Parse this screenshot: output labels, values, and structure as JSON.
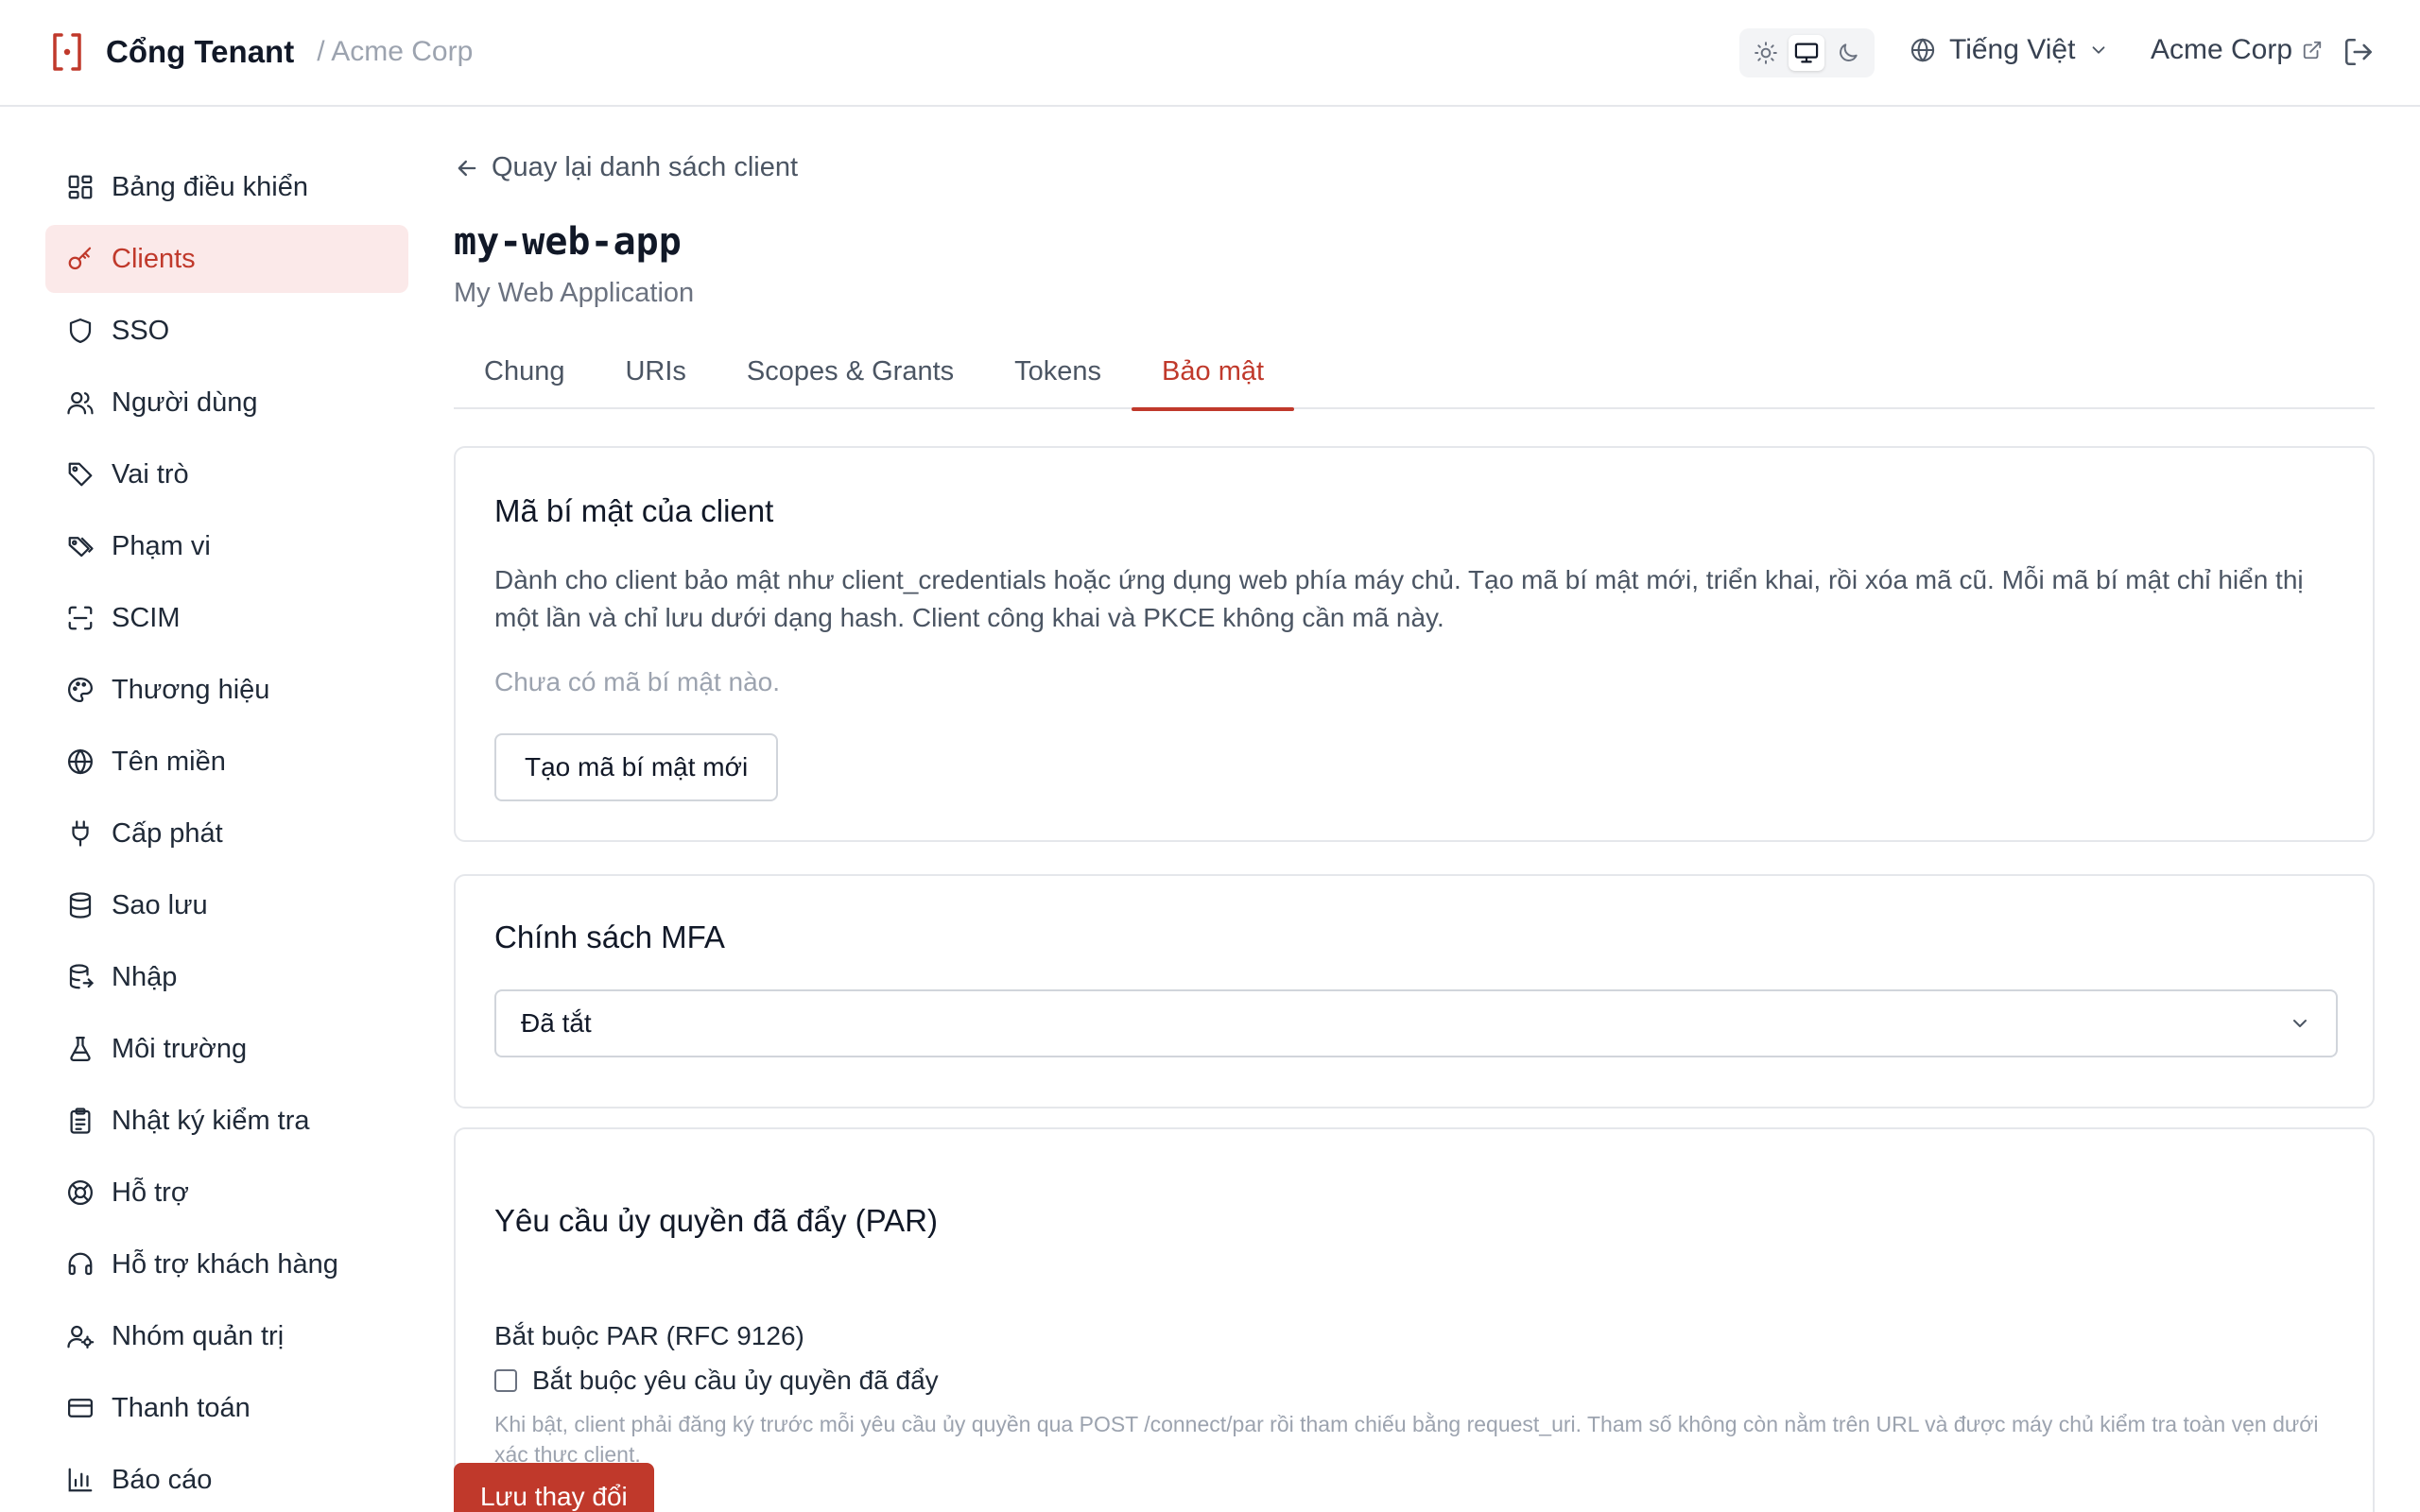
{
  "header": {
    "brand_name": "Cổng Tenant",
    "breadcrumb_org": "/ Acme Corp",
    "language": "Tiếng Việt",
    "org_name": "Acme Corp",
    "accent_color": "#c0392b"
  },
  "sidebar": {
    "items": [
      {
        "label": "Bảng điều khiển",
        "icon": "dashboard-icon"
      },
      {
        "label": "Clients",
        "icon": "key-icon",
        "active": true
      },
      {
        "label": "SSO",
        "icon": "shield-icon"
      },
      {
        "label": "Người dùng",
        "icon": "users-icon"
      },
      {
        "label": "Vai trò",
        "icon": "tag-icon"
      },
      {
        "label": "Phạm vi",
        "icon": "tags-icon"
      },
      {
        "label": "SCIM",
        "icon": "scan-icon"
      },
      {
        "label": "Thương hiệu",
        "icon": "palette-icon"
      },
      {
        "label": "Tên miền",
        "icon": "globe-icon"
      },
      {
        "label": "Cấp phát",
        "icon": "plug-icon"
      },
      {
        "label": "Sao lưu",
        "icon": "database-icon"
      },
      {
        "label": "Nhập",
        "icon": "database-import-icon"
      },
      {
        "label": "Môi trường",
        "icon": "flask-icon"
      },
      {
        "label": "Nhật ký kiểm tra",
        "icon": "clipboard-icon"
      },
      {
        "label": "Hỗ trợ",
        "icon": "lifebuoy-icon"
      },
      {
        "label": "Hỗ trợ khách hàng",
        "icon": "headset-icon"
      },
      {
        "label": "Nhóm quản trị",
        "icon": "user-cog-icon"
      },
      {
        "label": "Thanh toán",
        "icon": "credit-card-icon"
      },
      {
        "label": "Báo cáo",
        "icon": "bar-chart-icon"
      }
    ]
  },
  "main": {
    "back_link": "Quay lại danh sách client",
    "client_id": "my-web-app",
    "client_name": "My Web Application",
    "tabs": [
      {
        "label": "Chung"
      },
      {
        "label": "URIs"
      },
      {
        "label": "Scopes & Grants"
      },
      {
        "label": "Tokens"
      },
      {
        "label": "Bảo mật",
        "active": true
      }
    ],
    "secret_card": {
      "title": "Mã bí mật của client",
      "description": "Dành cho client bảo mật như client_credentials hoặc ứng dụng web phía máy chủ. Tạo mã bí mật mới, triển khai, rồi xóa mã cũ. Mỗi mã bí mật chỉ hiển thị một lần và chỉ lưu dưới dạng hash. Client công khai và PKCE không cần mã này.",
      "empty_text": "Chưa có mã bí mật nào.",
      "create_button": "Tạo mã bí mật mới"
    },
    "mfa_card": {
      "title": "Chính sách MFA",
      "selected": "Đã tắt"
    },
    "par_card": {
      "title": "Yêu cầu ủy quyền đã đẩy (PAR)",
      "field_label": "Bắt buộc PAR (RFC 9126)",
      "checkbox_label": "Bắt buộc yêu cầu ủy quyền đã đẩy",
      "checked": false,
      "hint": "Khi bật, client phải đăng ký trước mỗi yêu cầu ủy quyền qua POST /connect/par rồi tham chiếu bằng request_uri. Tham số không còn nằm trên URL và được máy chủ kiểm tra toàn vẹn dưới xác thực client."
    },
    "save_button": "Lưu thay đổi"
  }
}
